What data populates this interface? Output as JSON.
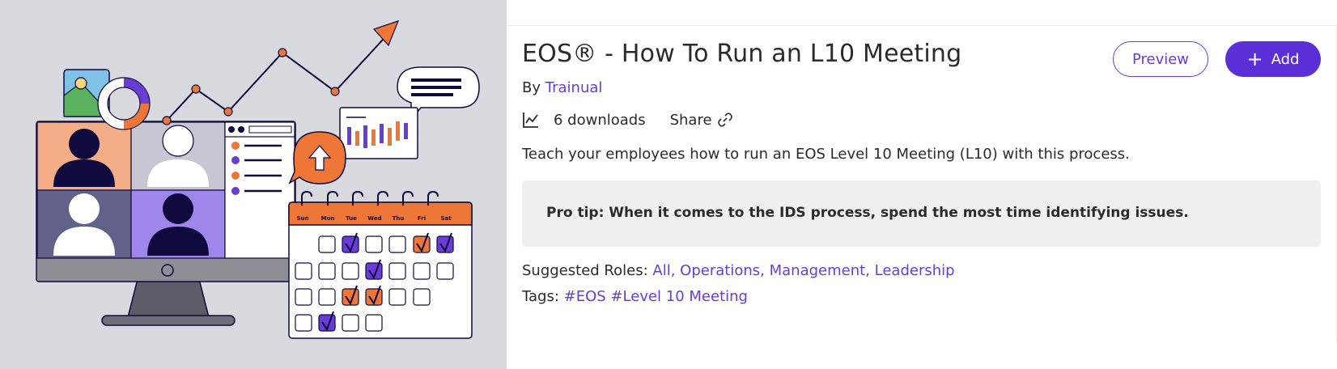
{
  "course": {
    "title": "EOS® - How To Run an L10 Meeting",
    "by_prefix": "By",
    "author": "Trainual",
    "downloads": "6 downloads",
    "share_label": "Share",
    "description": "Teach your employees how to run an EOS Level 10 Meeting (L10) with this process.",
    "pro_tip": "Pro tip: When it comes to the IDS process, spend the most time identifying issues.",
    "roles_label": "Suggested Roles:",
    "roles": [
      "All,",
      "Operations,",
      "Management,",
      "Leadership"
    ],
    "tags_label": "Tags:",
    "tags": [
      "#EOS",
      "#Level 10 Meeting"
    ]
  },
  "actions": {
    "preview_label": "Preview",
    "add_label": "Add"
  },
  "calendar": {
    "days": [
      "Sun",
      "Mon",
      "Tue",
      "Wed",
      "Thu",
      "Fri",
      "Sat"
    ]
  },
  "colors": {
    "accent": "#6a3cd6",
    "accent_button": "#5a2fd8",
    "orange": "#ee7636",
    "navy": "#0e0a3d",
    "hero_bg": "#d9d9e0",
    "tip_bg": "#f0f0f0"
  },
  "icons": [
    "downloads-chart-icon",
    "share-link-icon",
    "plus-icon"
  ]
}
